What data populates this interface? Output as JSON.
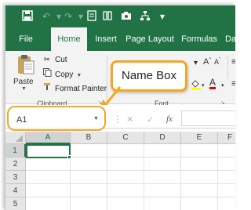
{
  "colors": {
    "accent": "#217346",
    "callout": "#f5a623"
  },
  "quick_access": {
    "icons": [
      "save-icon",
      "undo-icon",
      "redo-icon",
      "print-preview-icon",
      "format-painter-icon",
      "camera-icon",
      "sitemap-icon",
      "customize-icon"
    ]
  },
  "tabs": [
    {
      "label": "File"
    },
    {
      "label": "Home"
    },
    {
      "label": "Insert"
    },
    {
      "label": "Page Layout"
    },
    {
      "label": "Formulas"
    },
    {
      "label": "Dat"
    }
  ],
  "ribbon": {
    "clipboard": {
      "paste": "Paste",
      "cut": "Cut",
      "copy": "Copy",
      "format_painter": "Format Painter",
      "group_label": "Clipboard"
    },
    "font": {
      "group_label": "Font"
    }
  },
  "callout": {
    "label": "Name Box"
  },
  "formula_bar": {
    "name_box_value": "A1",
    "cancel_icon": "✕",
    "enter_icon": "✓",
    "function_icon": "fx"
  },
  "grid": {
    "columns": [
      "A",
      "B",
      "C",
      "D",
      "E",
      "F"
    ],
    "rows": [
      "1",
      "2",
      "3",
      "4",
      "5"
    ],
    "selected_cell": "A1"
  }
}
